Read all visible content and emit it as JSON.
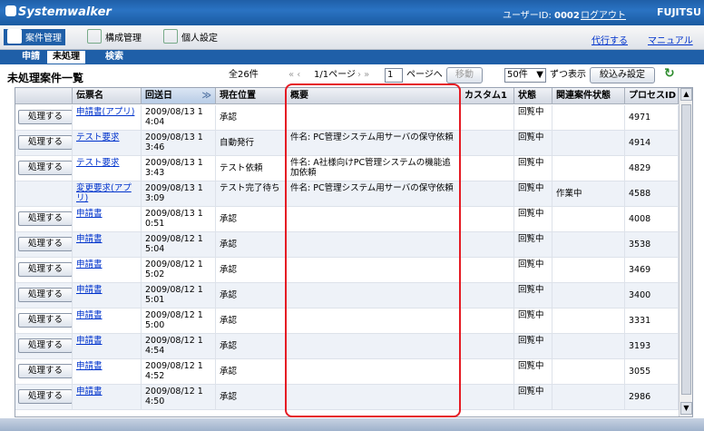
{
  "app": {
    "logo": "Systemwalker",
    "user_label": "ユーザーID:",
    "user_id": "0002",
    "logout": "ログアウト",
    "brand": "FUJITSU"
  },
  "menu": {
    "tabs": [
      {
        "label": "案件管理",
        "icon": "check-icon"
      },
      {
        "label": "構成管理",
        "icon": "config-icon"
      },
      {
        "label": "個人設定",
        "icon": "settings-icon"
      }
    ],
    "right_links": [
      "代行する",
      "マニュアル"
    ]
  },
  "subtabs": [
    "申請",
    "未処理",
    "検索"
  ],
  "page_title": "未処理案件一覧",
  "pager": {
    "total": "全26件",
    "page": "1/1ページ",
    "page_input": "1",
    "goto_label": "ページへ",
    "move_button": "移動",
    "per_page": "50件",
    "per_page_suffix": "ずつ表示",
    "filter_button": "絞込み設定"
  },
  "table": {
    "columns": [
      "",
      "伝票名",
      "回送日",
      "現在位置",
      "概要",
      "カスタム1",
      "状態",
      "関連案件状態",
      "プロセスID"
    ],
    "rows": [
      {
        "btn": "処理する",
        "name": "申請書(アプリ)",
        "date": "2009/08/13 1",
        "time": "4:04",
        "pos": "承認",
        "summary": "",
        "custom": "",
        "status": "回覧中",
        "rel": "",
        "pid": "4971"
      },
      {
        "btn": "処理する",
        "name": "テスト要求",
        "date": "2009/08/13 1",
        "time": "3:46",
        "pos": "自動発行",
        "summary": "件名: PC管理システム用サーバの保守依頼",
        "custom": "",
        "status": "回覧中",
        "rel": "",
        "pid": "4914"
      },
      {
        "btn": "処理する",
        "name": "テスト要求",
        "date": "2009/08/13 1",
        "time": "3:43",
        "pos": "テスト依頼",
        "summary": "件名: A社様向けPC管理システムの機能追加依頼",
        "custom": "",
        "status": "回覧中",
        "rel": "",
        "pid": "4829"
      },
      {
        "btn": "",
        "name": "変更要求(アプリ)",
        "date": "2009/08/13 1",
        "time": "3:09",
        "pos": "テスト完了待ち",
        "summary": "件名: PC管理システム用サーバの保守依頼",
        "custom": "",
        "status": "回覧中",
        "rel": "作業中",
        "pid": "4588"
      },
      {
        "btn": "処理する",
        "name": "申請書",
        "date": "2009/08/13 1",
        "time": "0:51",
        "pos": "承認",
        "summary": "",
        "custom": "",
        "status": "回覧中",
        "rel": "",
        "pid": "4008"
      },
      {
        "btn": "処理する",
        "name": "申請書",
        "date": "2009/08/12 1",
        "time": "5:04",
        "pos": "承認",
        "summary": "",
        "custom": "",
        "status": "回覧中",
        "rel": "",
        "pid": "3538"
      },
      {
        "btn": "処理する",
        "name": "申請書",
        "date": "2009/08/12 1",
        "time": "5:02",
        "pos": "承認",
        "summary": "",
        "custom": "",
        "status": "回覧中",
        "rel": "",
        "pid": "3469"
      },
      {
        "btn": "処理する",
        "name": "申請書",
        "date": "2009/08/12 1",
        "time": "5:01",
        "pos": "承認",
        "summary": "",
        "custom": "",
        "status": "回覧中",
        "rel": "",
        "pid": "3400"
      },
      {
        "btn": "処理する",
        "name": "申請書",
        "date": "2009/08/12 1",
        "time": "5:00",
        "pos": "承認",
        "summary": "",
        "custom": "",
        "status": "回覧中",
        "rel": "",
        "pid": "3331"
      },
      {
        "btn": "処理する",
        "name": "申請書",
        "date": "2009/08/12 1",
        "time": "4:54",
        "pos": "承認",
        "summary": "",
        "custom": "",
        "status": "回覧中",
        "rel": "",
        "pid": "3193"
      },
      {
        "btn": "処理する",
        "name": "申請書",
        "date": "2009/08/12 1",
        "time": "4:52",
        "pos": "承認",
        "summary": "",
        "custom": "",
        "status": "回覧中",
        "rel": "",
        "pid": "3055"
      },
      {
        "btn": "処理する",
        "name": "申請書",
        "date": "2009/08/12 1",
        "time": "4:50",
        "pos": "承認",
        "summary": "",
        "custom": "",
        "status": "回覧中",
        "rel": "",
        "pid": "2986"
      }
    ]
  },
  "colors": {
    "header_blue": "#1f5fa8",
    "highlight": "#e51b24"
  }
}
